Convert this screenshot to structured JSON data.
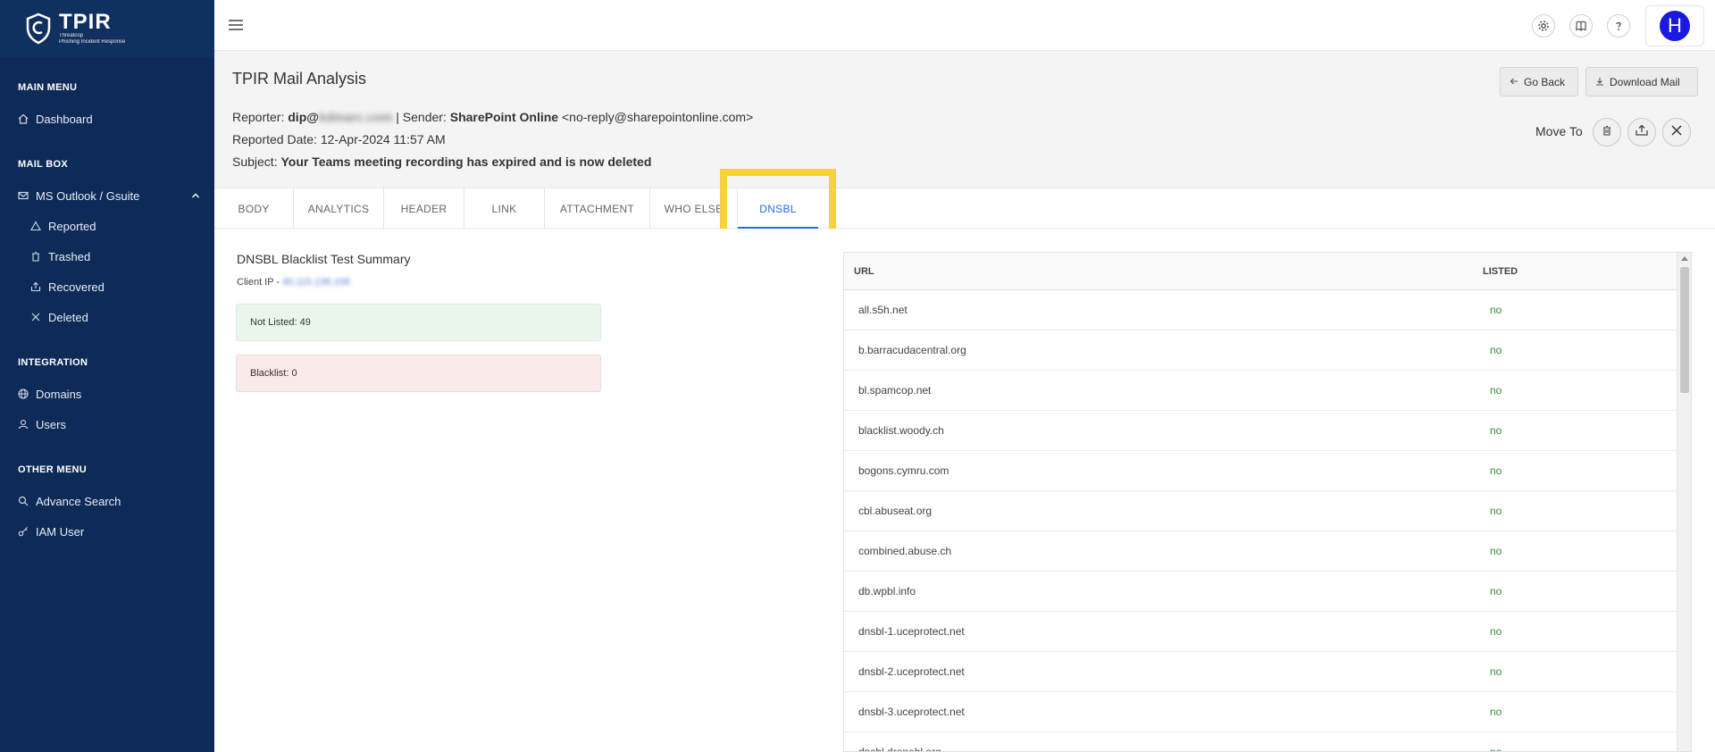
{
  "brand": {
    "name": "TPIR",
    "tagline_1": "Threatcop",
    "tagline_2": "Phishing Incident Response"
  },
  "sidebar": {
    "main_menu": "MAIN MENU",
    "dashboard": "Dashboard",
    "mail_box": "MAIL BOX",
    "ms_outlook": "MS Outlook / Gsuite",
    "reported": "Reported",
    "trashed": "Trashed",
    "recovered": "Recovered",
    "deleted": "Deleted",
    "integration": "INTEGRATION",
    "domains": "Domains",
    "users": "Users",
    "other_menu": "OTHER MENU",
    "advance_search": "Advance Search",
    "iam_user": "IAM User"
  },
  "topbar": {
    "avatar_letter": "H"
  },
  "header": {
    "title": "TPIR Mail Analysis",
    "reporter_label": "Reporter:",
    "reporter_user": "dip@",
    "reporter_domain": "kdmarc.com",
    "sender_label": "| Sender:",
    "sender_name": "SharePoint Online",
    "sender_email": "<no-reply@sharepointonline.com>",
    "date_label": "Reported Date:",
    "date_value": "12-Apr-2024 11:57 AM",
    "subject_label": "Subject:",
    "subject_value": "Your Teams meeting recording has expired and is now deleted",
    "go_back": "Go Back",
    "download_mail": "Download Mail",
    "move_to": "Move To"
  },
  "tabs": {
    "body": "BODY",
    "analytics": "ANALYTICS",
    "header": "HEADER",
    "link": "LINK",
    "attachment": "ATTACHMENT",
    "who_else": "WHO ELSE",
    "dnsbl": "DNSBL"
  },
  "dnsbl": {
    "summary_title": "DNSBL Blacklist Test Summary",
    "client_ip_label": "Client IP -",
    "client_ip_value": "40.115.138.108",
    "not_listed": "Not Listed: 49",
    "blacklist": "Blacklist: 0",
    "col_url": "URL",
    "col_listed": "LISTED",
    "rows": [
      {
        "url": "all.s5h.net",
        "listed": "no"
      },
      {
        "url": "b.barracudacentral.org",
        "listed": "no"
      },
      {
        "url": "bl.spamcop.net",
        "listed": "no"
      },
      {
        "url": "blacklist.woody.ch",
        "listed": "no"
      },
      {
        "url": "bogons.cymru.com",
        "listed": "no"
      },
      {
        "url": "cbl.abuseat.org",
        "listed": "no"
      },
      {
        "url": "combined.abuse.ch",
        "listed": "no"
      },
      {
        "url": "db.wpbl.info",
        "listed": "no"
      },
      {
        "url": "dnsbl-1.uceprotect.net",
        "listed": "no"
      },
      {
        "url": "dnsbl-2.uceprotect.net",
        "listed": "no"
      },
      {
        "url": "dnsbl-3.uceprotect.net",
        "listed": "no"
      },
      {
        "url": "dnsbl.dronebl.org",
        "listed": "no"
      }
    ]
  },
  "colors": {
    "sidebar": "#0e2a57",
    "accent": "#2a6dd8",
    "highlight": "#f7d23a",
    "avatar": "#1a1adf",
    "listed_no": "#2f8f2f"
  }
}
